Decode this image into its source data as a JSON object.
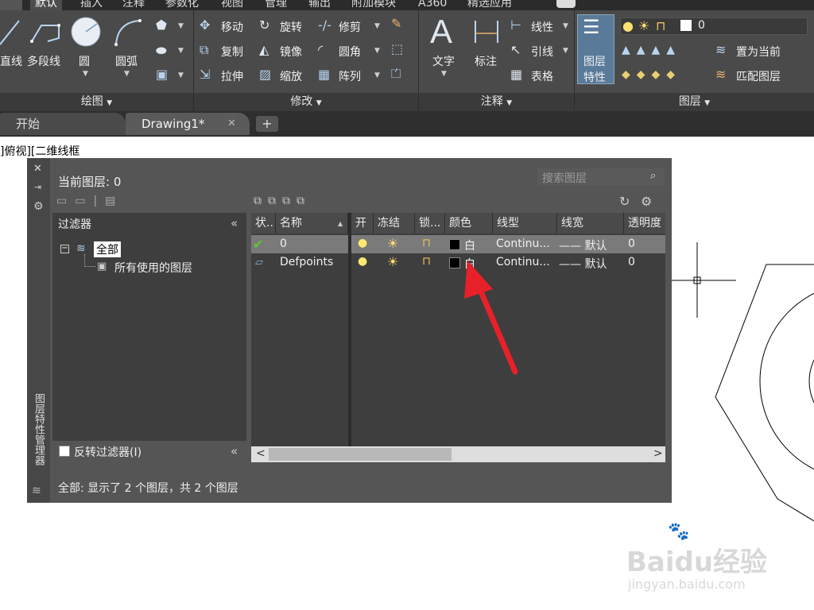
{
  "ribbon": {
    "tabs": [
      "默认",
      "插入",
      "注释",
      "参数化",
      "视图",
      "管理",
      "输出",
      "附加模块",
      "A360",
      "精选应用"
    ],
    "draw_panel": {
      "title": "绘图",
      "tools": [
        "直线",
        "多段线",
        "圆",
        "圆弧"
      ]
    },
    "modify_panel": {
      "title": "修改",
      "tools": [
        "移动",
        "旋转",
        "修剪",
        "复制",
        "镜像",
        "圆角",
        "拉伸",
        "缩放",
        "阵列"
      ]
    },
    "annotation_panel": {
      "title": "注释",
      "tools": [
        "文字",
        "标注",
        "线性",
        "引线",
        "表格"
      ]
    },
    "layers_panel": {
      "title": "图层",
      "props_label_line1": "图层",
      "props_label_line2": "特性",
      "current_layer_value": "0",
      "set_current": "置为当前",
      "match_layer": "匹配图层"
    }
  },
  "doc_tabs": {
    "start": "开始",
    "drawing": "Drawing1*",
    "close_symbol": "✕",
    "add_symbol": "+"
  },
  "viewport_label": "]俯视][二维线框",
  "palette": {
    "vertical_title": "图层特性管理器",
    "current_layer_label": "当前图层: 0",
    "search_placeholder": "搜索图层",
    "filters_header": "过滤器",
    "tree_all": "全部",
    "tree_used": "所有使用的图层",
    "invert_filter_label": "反转过滤器(I)",
    "status_text": "全部: 显示了 2 个图层，共 2 个图层",
    "columns": [
      "状..",
      "名称",
      "开",
      "冻结",
      "锁...",
      "颜色",
      "线型",
      "线宽",
      "透明度"
    ],
    "rows": [
      {
        "name": "0",
        "color_label": "白",
        "linetype": "Continu...",
        "lineweight": "—— 默认",
        "transparency": "0",
        "selected": true
      },
      {
        "name": "Defpoints",
        "color_label": "白",
        "linetype": "Continu...",
        "lineweight": "—— 默认",
        "transparency": "0",
        "selected": false
      }
    ]
  },
  "icons": {
    "check": "✔",
    "bulb": "💡",
    "sun": "☀",
    "lock": "🔓",
    "collapse": "«",
    "scroll_left": "<",
    "scroll_right": ">"
  },
  "watermark": {
    "brand": "Baidu经验",
    "url": "jingyan.baidu.com"
  },
  "colors": {
    "accent_arrow": "#e8202a",
    "selected_row": "#7a7a7a"
  }
}
